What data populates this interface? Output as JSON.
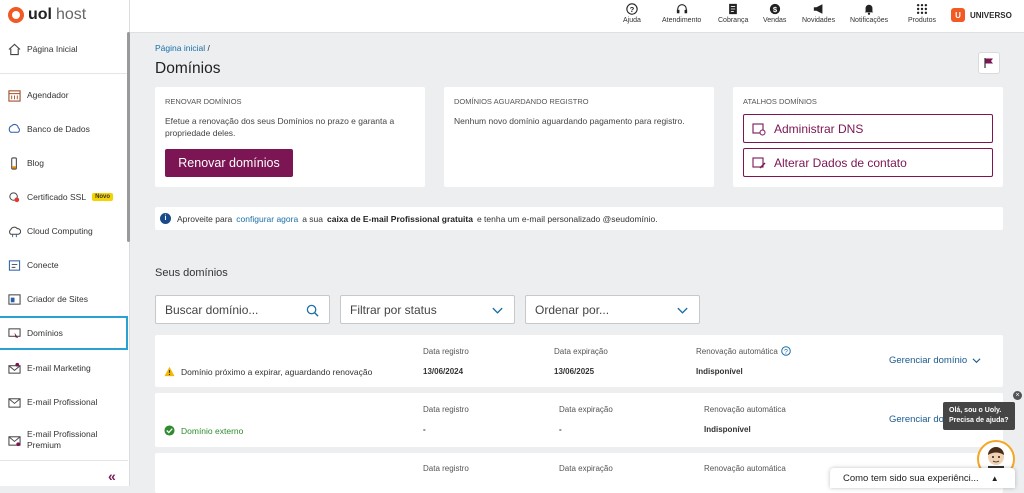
{
  "brand": {
    "name": "uol",
    "product": "host"
  },
  "sidebar": {
    "items": [
      {
        "label": "Página Inicial",
        "icon": "home-icon"
      },
      {
        "label": "Agendador",
        "icon": "calendar-icon"
      },
      {
        "label": "Banco de Dados",
        "icon": "database-icon"
      },
      {
        "label": "Blog",
        "icon": "blog-icon"
      },
      {
        "label": "Certificado SSL",
        "icon": "certificate-icon",
        "badge": "Novo"
      },
      {
        "label": "Cloud Computing",
        "icon": "cloud-icon"
      },
      {
        "label": "Conecte",
        "icon": "connect-icon"
      },
      {
        "label": "Criador de Sites",
        "icon": "site-builder-icon"
      },
      {
        "label": "Domínios",
        "icon": "domain-icon"
      },
      {
        "label": "E-mail Marketing",
        "icon": "email-marketing-icon"
      },
      {
        "label": "E-mail Profissional",
        "icon": "email-icon"
      },
      {
        "label": "E-mail Profissional Premium",
        "icon": "email-premium-icon"
      }
    ],
    "active": "Domínios",
    "collapse": "«"
  },
  "topbar": {
    "items": [
      {
        "label": "Ajuda",
        "icon": "help-icon"
      },
      {
        "label": "Atendimento",
        "icon": "headset-icon"
      },
      {
        "label": "Cobrança",
        "icon": "invoice-icon"
      },
      {
        "label": "Vendas",
        "icon": "sales-icon"
      },
      {
        "label": "Novidades",
        "icon": "megaphone-icon"
      },
      {
        "label": "Notificações",
        "icon": "bell-icon"
      },
      {
        "label": "Produtos",
        "icon": "grid-icon"
      }
    ],
    "user": {
      "avatar": "U",
      "label": "UNIVERSO"
    }
  },
  "breadcrumb": {
    "home": "Página inicial",
    "sep": "/"
  },
  "page_title": "Domínios",
  "cards": {
    "renew": {
      "heading": "RENOVAR DOMÍNIOS",
      "text": "Efetue a renovação dos seus Domínios no prazo e garanta a propriedade deles.",
      "button": "Renovar domínios"
    },
    "pending": {
      "heading": "DOMÍNIOS AGUARDANDO REGISTRO",
      "text": "Nenhum novo domínio aguardando pagamento para registro."
    },
    "shortcuts": {
      "heading": "ATALHOS DOMÍNIOS",
      "dns": "Administrar DNS",
      "contact": "Alterar Dados de contato"
    }
  },
  "info_bar": {
    "a": "Aproveite para",
    "link": "configurar agora",
    "b": "a sua",
    "bold": "caixa de E-mail Profissional gratuita",
    "c": "e tenha um e-mail personalizado @seudomínio."
  },
  "domains_title": "Seus domínios",
  "search": {
    "placeholder": "Buscar domínio..."
  },
  "filter": {
    "label": "Filtrar por status"
  },
  "order": {
    "label": "Ordenar por..."
  },
  "columns": {
    "registered": "Data registro",
    "expires": "Data expiração",
    "auto_renew": "Renovação automática"
  },
  "rows": [
    {
      "status": "Domínio próximo a expirar, aguardando renovação",
      "registered": "13/06/2024",
      "expires": "13/06/2025",
      "auto_renew": "Indisponível",
      "action": "Gerenciar domínio"
    },
    {
      "status": "Domínio externo",
      "registered": "-",
      "expires": "-",
      "auto_renew": "Indisponível",
      "action": "Gerenciar do"
    },
    {
      "status": "",
      "registered": "",
      "expires": "",
      "auto_renew": "",
      "action": ""
    }
  ],
  "assistant": {
    "bubble_line1": "Olá, sou o Uoly.",
    "bubble_line2": "Precisa de ajuda?",
    "close": "×"
  },
  "survey": {
    "text": "Como tem sido sua experiênci...",
    "caret": "▲"
  },
  "colors": {
    "primary": "#7b1553",
    "link": "#1a6fa8",
    "warning": "#f5b800",
    "success": "#2e8b2e",
    "brand": "#f15a22"
  }
}
